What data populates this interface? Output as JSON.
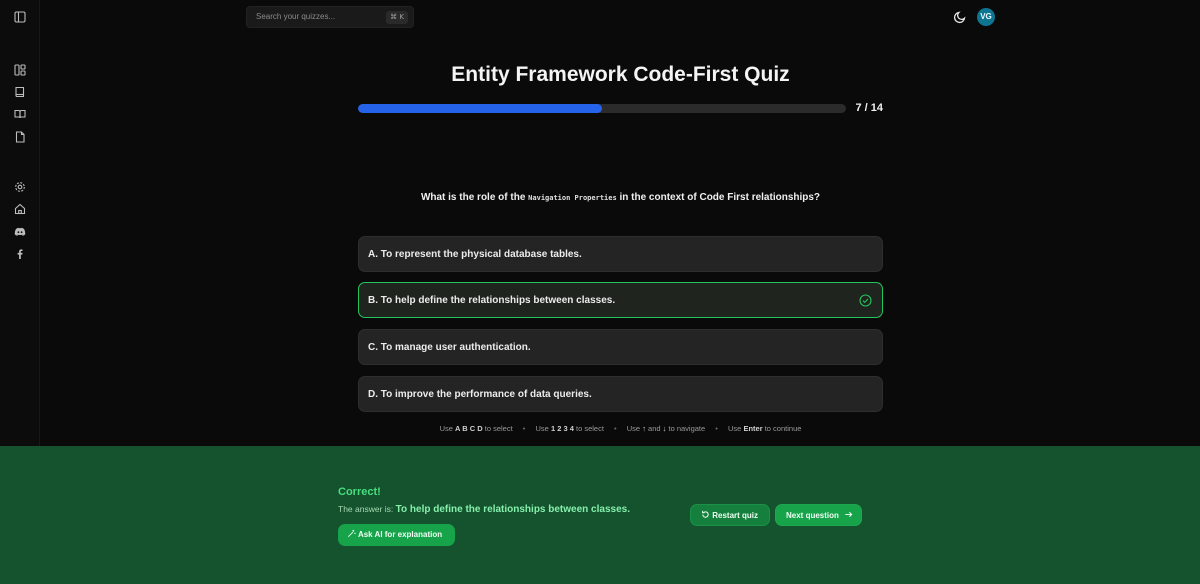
{
  "sidebar": {
    "icons": [
      "panel-toggle-icon",
      "dashboard-icon",
      "book-icon",
      "book-open-icon",
      "file-icon",
      "settings-icon",
      "home-icon",
      "discord-icon",
      "facebook-icon"
    ]
  },
  "search": {
    "placeholder": "Search your quizzes...",
    "shortcut": "⌘ K"
  },
  "header": {
    "avatar_initials": "VG"
  },
  "quiz": {
    "title": "Entity Framework Code-First Quiz",
    "progress": {
      "current": 7,
      "total": 14,
      "label": "7 / 14"
    },
    "question": {
      "prefix": "What is the role of the",
      "code": "Navigation Properties",
      "suffix": "in the context of Code First relationships?"
    },
    "options": [
      {
        "label": "A. To represent the physical database tables.",
        "state": "default"
      },
      {
        "label": "B. To help define the relationships between classes.",
        "state": "correct"
      },
      {
        "label": "C. To manage user authentication.",
        "state": "default"
      },
      {
        "label": "D. To improve the performance of data queries.",
        "state": "default"
      }
    ],
    "hints": [
      {
        "pre": "Use",
        "key": "A B C D",
        "post": "to select"
      },
      {
        "pre": "Use",
        "key": "1 2 3 4",
        "post": "to select"
      },
      {
        "pre": "Use",
        "key": "↑",
        "mid": "and",
        "key2": "↓",
        "post": "to navigate"
      },
      {
        "pre": "Use",
        "key": "Enter",
        "post": "to continue"
      }
    ]
  },
  "feedback": {
    "title": "Correct!",
    "answer_prefix": "The answer is:",
    "answer": "To help define the relationships between classes.",
    "ask_ai_label": "Ask AI for explanation",
    "restart_label": "Restart quiz",
    "next_label": "Next question"
  },
  "colors": {
    "accent_blue": "#2563eb",
    "correct_green": "#22c55e",
    "feedback_bg": "#14532d",
    "avatar_bg": "#0e7490"
  }
}
